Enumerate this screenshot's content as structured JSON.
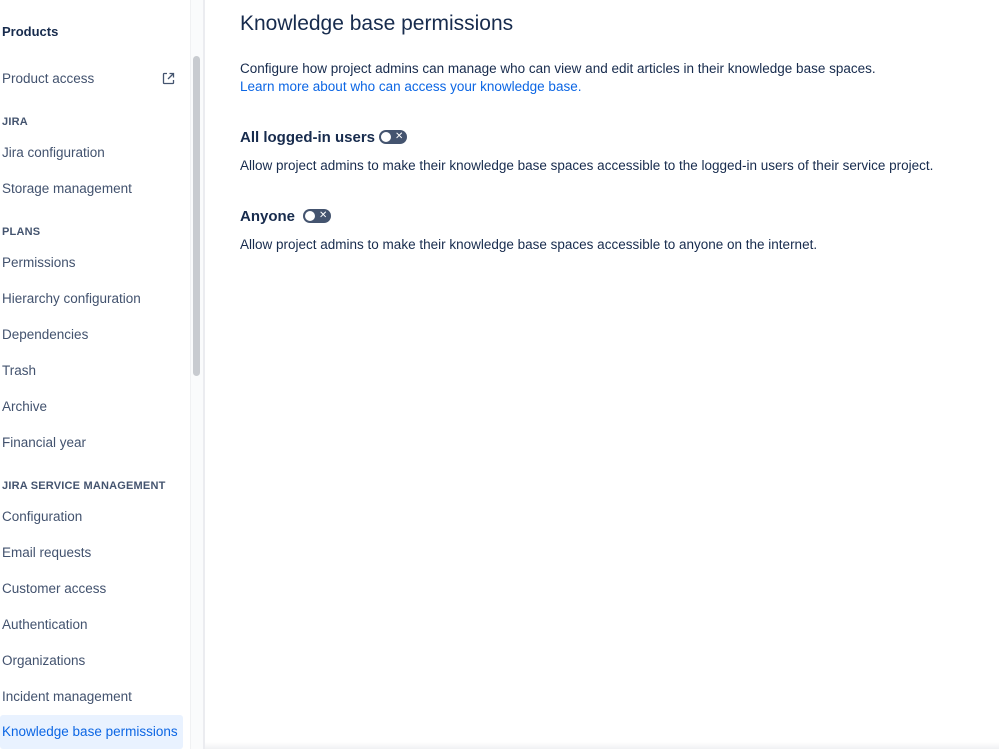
{
  "sidebar": {
    "title": "Products",
    "product_access": "Product access",
    "sections": {
      "jira": "JIRA",
      "plans": "PLANS",
      "jsm": "JIRA SERVICE MANAGEMENT"
    },
    "jira_items": [
      "Jira configuration",
      "Storage management"
    ],
    "plans_items": [
      "Permissions",
      "Hierarchy configuration",
      "Dependencies",
      "Trash",
      "Archive",
      "Financial year"
    ],
    "jsm_items": [
      "Configuration",
      "Email requests",
      "Customer access",
      "Authentication",
      "Organizations",
      "Incident management",
      "Knowledge base permissions"
    ],
    "active_item": "Knowledge base permissions"
  },
  "main": {
    "title": "Knowledge base permissions",
    "description": "Configure how project admins can manage who can view and edit articles in their knowledge base spaces.",
    "learn_more": "Learn more about who can access your knowledge base.",
    "options": [
      {
        "title": "All logged-in users",
        "enabled": false,
        "description": "Allow project admins to make their knowledge base spaces accessible to the logged-in users of their service project."
      },
      {
        "title": "Anyone",
        "enabled": false,
        "description": "Allow project admins to make their knowledge base spaces accessible to anyone on the internet."
      }
    ]
  },
  "colors": {
    "accent": "#0c66e4",
    "active_bg": "#e9f2ff",
    "toggle_off": "#44546f"
  }
}
